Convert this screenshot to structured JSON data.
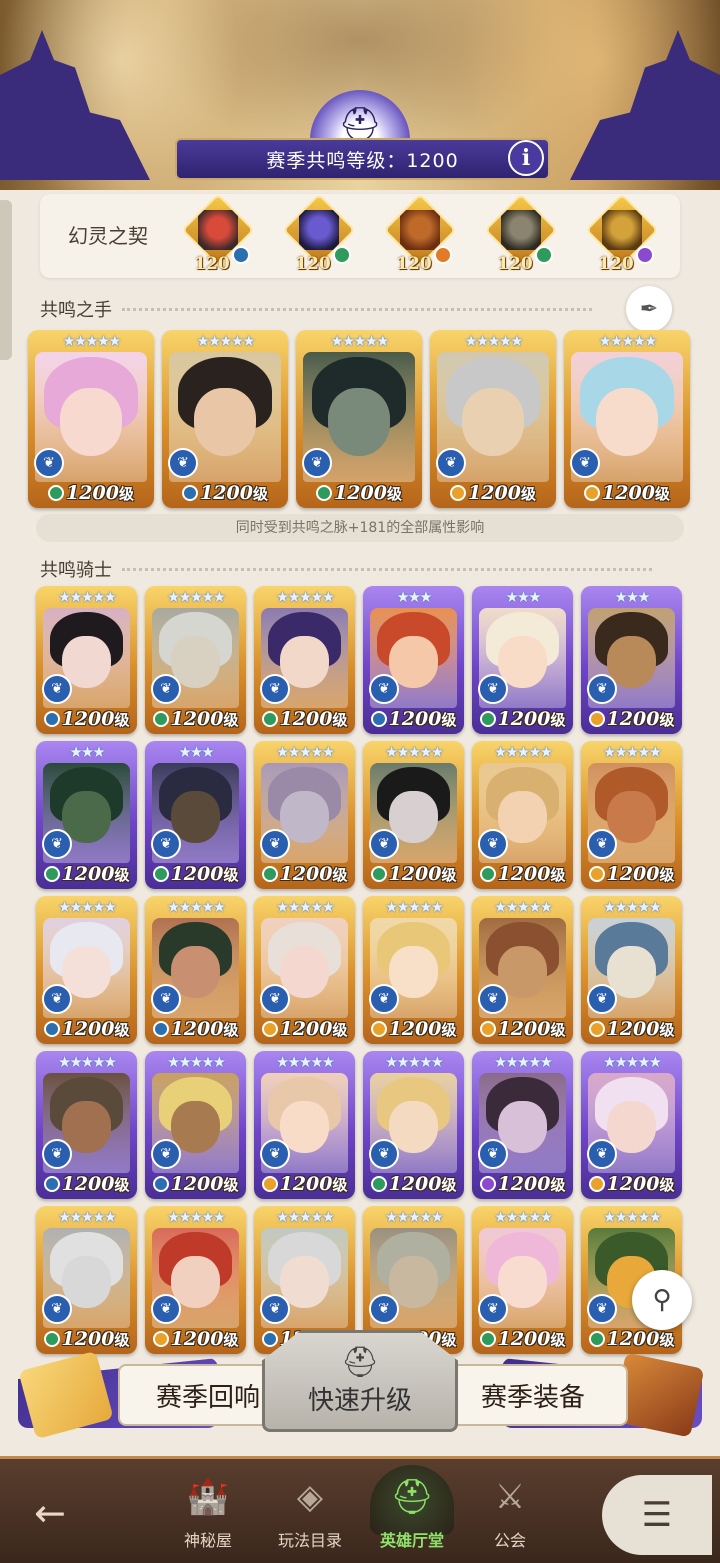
{
  "header": {
    "season_level_label": "赛季共鸣等级：1200",
    "info_label": "i"
  },
  "contract": {
    "title": "幻灵之契",
    "items": [
      {
        "level": "120",
        "colors": [
          "#d84a3a",
          "#3a2a2a"
        ],
        "elem_color": "#2c6fb0"
      },
      {
        "level": "120",
        "colors": [
          "#6a5ad0",
          "#1d1a40"
        ],
        "elem_color": "#2e9a5e"
      },
      {
        "level": "120",
        "colors": [
          "#c06a2a",
          "#6b2e10"
        ],
        "elem_color": "#e27a2a"
      },
      {
        "level": "120",
        "colors": [
          "#8a8470",
          "#2e2a20"
        ],
        "elem_color": "#2e9a5e"
      },
      {
        "level": "120",
        "colors": [
          "#d4a23a",
          "#5a3a10"
        ],
        "elem_color": "#8a4ad0"
      }
    ]
  },
  "hand": {
    "label": "共鸣之手",
    "note": "同时受到共鸣之脉+181的全部属性影响",
    "cards": [
      {
        "level": "1200",
        "suffix": "级",
        "stars": "★★★★★",
        "frame": "gold",
        "hair": "#e7a9d8",
        "face": "#f7d9d0",
        "bg": "#f3d3ea",
        "elem": "#2e9a5e"
      },
      {
        "level": "1200",
        "suffix": "级",
        "stars": "★★★★★",
        "frame": "gold",
        "hair": "#2a221e",
        "face": "#e9c7a6",
        "bg": "#d8c6a0",
        "elem": "#2c6fb0"
      },
      {
        "level": "1200",
        "suffix": "级",
        "stars": "★★★★★",
        "frame": "gold",
        "hair": "#1f2a2a",
        "face": "#7a8a7a",
        "bg": "#4a5a4a",
        "elem": "#2e9a5e"
      },
      {
        "level": "1200",
        "suffix": "级",
        "stars": "★★★★★",
        "frame": "gold",
        "hair": "#c8c8c8",
        "face": "#e8d0b0",
        "bg": "#d0c8b0",
        "elem": "#e8a22a"
      },
      {
        "level": "1200",
        "suffix": "级",
        "stars": "★★★★★",
        "frame": "gold",
        "hair": "#a8d8e8",
        "face": "#f7dccc",
        "bg": "#f2d0d8",
        "elem": "#e8a22a"
      }
    ]
  },
  "knights": {
    "label": "共鸣骑士",
    "cards": [
      {
        "level": "1200",
        "suffix": "级",
        "stars": "★★★★★",
        "frame": "gold",
        "hair": "#1e1a1e",
        "face": "#f1d8d0",
        "bg": "#d6b0c0",
        "elem": "#2c6fb0"
      },
      {
        "level": "1200",
        "suffix": "级",
        "stars": "★★★★★",
        "frame": "gold",
        "hair": "#d6d6d0",
        "face": "#d8d0c0",
        "bg": "#a8a8a0",
        "elem": "#2e9a5e"
      },
      {
        "level": "1200",
        "suffix": "级",
        "stars": "★★★★★",
        "frame": "gold",
        "hair": "#3a2a6a",
        "face": "#f2d8c8",
        "bg": "#8a7ab0",
        "elem": "#2e9a5e"
      },
      {
        "level": "1200",
        "suffix": "级",
        "stars": "★★★",
        "frame": "purple",
        "hair": "#c84a2a",
        "face": "#f4c8a8",
        "bg": "#e89050",
        "elem": "#2c6fb0"
      },
      {
        "level": "1200",
        "suffix": "级",
        "stars": "★★★",
        "frame": "purple",
        "hair": "#f4ead8",
        "face": "#f8dcc8",
        "bg": "#f0dcc8",
        "elem": "#2e9a5e"
      },
      {
        "level": "1200",
        "suffix": "级",
        "stars": "★★★",
        "frame": "purple",
        "hair": "#3a2a1e",
        "face": "#b88a5a",
        "bg": "#c0a070",
        "elem": "#e8a22a"
      },
      {
        "level": "1200",
        "suffix": "级",
        "stars": "★★★",
        "frame": "purple",
        "hair": "#1e3a2a",
        "face": "#4a6a4a",
        "bg": "#2a4a3a",
        "elem": "#2e9a5e"
      },
      {
        "level": "1200",
        "suffix": "级",
        "stars": "★★★",
        "frame": "purple",
        "hair": "#2a2a40",
        "face": "#5a4a3a",
        "bg": "#3a3a5a",
        "elem": "#2e9a5e"
      },
      {
        "level": "1200",
        "suffix": "级",
        "stars": "★★★★★",
        "frame": "gold",
        "hair": "#9a8aa8",
        "face": "#c0b8c8",
        "bg": "#a898b8",
        "elem": "#2e9a5e"
      },
      {
        "level": "1200",
        "suffix": "级",
        "stars": "★★★★★",
        "frame": "gold",
        "hair": "#1a1a1a",
        "face": "#d8d0d0",
        "bg": "#6a7a6a",
        "elem": "#2e9a5e"
      },
      {
        "level": "1200",
        "suffix": "级",
        "stars": "★★★★★",
        "frame": "gold",
        "hair": "#d8b070",
        "face": "#f2d2b0",
        "bg": "#e8c890",
        "elem": "#2e9a5e"
      },
      {
        "level": "1200",
        "suffix": "级",
        "stars": "★★★★★",
        "frame": "gold",
        "hair": "#b05a2a",
        "face": "#c87a4a",
        "bg": "#d09060",
        "elem": "#e8a22a"
      },
      {
        "level": "1200",
        "suffix": "级",
        "stars": "★★★★★",
        "frame": "gold",
        "hair": "#e8e8f0",
        "face": "#f4e0d8",
        "bg": "#e0d0e0",
        "elem": "#2c6fb0"
      },
      {
        "level": "1200",
        "suffix": "级",
        "stars": "★★★★★",
        "frame": "gold",
        "hair": "#2a3a2a",
        "face": "#c89070",
        "bg": "#b07050",
        "elem": "#2c6fb0"
      },
      {
        "level": "1200",
        "suffix": "级",
        "stars": "★★★★★",
        "frame": "gold",
        "hair": "#e8e0d8",
        "face": "#f4d8d0",
        "bg": "#f0d0c0",
        "elem": "#e8a22a"
      },
      {
        "level": "1200",
        "suffix": "级",
        "stars": "★★★★★",
        "frame": "gold",
        "hair": "#e8c878",
        "face": "#f8e0c8",
        "bg": "#f0d8a8",
        "elem": "#e8a22a"
      },
      {
        "level": "1200",
        "suffix": "级",
        "stars": "★★★★★",
        "frame": "gold",
        "hair": "#8a5030",
        "face": "#c89868",
        "bg": "#a06a40",
        "elem": "#e8a22a"
      },
      {
        "level": "1200",
        "suffix": "级",
        "stars": "★★★★★",
        "frame": "gold",
        "hair": "#5a7a9a",
        "face": "#e8e0d0",
        "bg": "#c8d0d8",
        "elem": "#e8a22a"
      },
      {
        "level": "1200",
        "suffix": "级",
        "stars": "★★★★★",
        "frame": "purple",
        "hair": "#5a4a3a",
        "face": "#a07050",
        "bg": "#6a5040",
        "elem": "#2c6fb0"
      },
      {
        "level": "1200",
        "suffix": "级",
        "stars": "★★★★★",
        "frame": "purple",
        "hair": "#e8d078",
        "face": "#a87a50",
        "bg": "#c8a060",
        "elem": "#2c6fb0"
      },
      {
        "level": "1200",
        "suffix": "级",
        "stars": "★★★★★",
        "frame": "purple",
        "hair": "#e8c8a8",
        "face": "#f8dcc8",
        "bg": "#f0d0b8",
        "elem": "#e8a22a"
      },
      {
        "level": "1200",
        "suffix": "级",
        "stars": "★★★★★",
        "frame": "purple",
        "hair": "#e8c880",
        "face": "#f4dac0",
        "bg": "#e8d0a0",
        "elem": "#2e9a5e"
      },
      {
        "level": "1200",
        "suffix": "级",
        "stars": "★★★★★",
        "frame": "purple",
        "hair": "#3a2a3a",
        "face": "#d8c0d8",
        "bg": "#8a6a8a",
        "elem": "#8a4ad0"
      },
      {
        "level": "1200",
        "suffix": "级",
        "stars": "★★★★★",
        "frame": "purple",
        "hair": "#f0e0f0",
        "face": "#f4d8d0",
        "bg": "#d8a8c8",
        "elem": "#e8a22a"
      },
      {
        "level": "1200",
        "suffix": "级",
        "stars": "★★★★★",
        "frame": "gold",
        "hair": "#e0e0e0",
        "face": "#d8d8d8",
        "bg": "#b0b0b0",
        "elem": "#2e9a5e"
      },
      {
        "level": "1200",
        "suffix": "级",
        "stars": "★★★★★",
        "frame": "gold",
        "hair": "#c03a2a",
        "face": "#f2d0c0",
        "bg": "#d86a5a",
        "elem": "#e8a22a"
      },
      {
        "level": "1200",
        "suffix": "级",
        "stars": "★★★★★",
        "frame": "gold",
        "hair": "#d8d8d8",
        "face": "#f0dcd0",
        "bg": "#c0c8c0",
        "elem": "#2c6fb0"
      },
      {
        "level": "1200",
        "suffix": "级",
        "stars": "★★★★★",
        "frame": "gold",
        "hair": "#b0b0a0",
        "face": "#c8b8a0",
        "bg": "#9a9080",
        "elem": "#2e9a5e"
      },
      {
        "level": "1200",
        "suffix": "级",
        "stars": "★★★★★",
        "frame": "gold",
        "hair": "#f0b8d8",
        "face": "#f8dcd0",
        "bg": "#f0c8d8",
        "elem": "#2e9a5e"
      },
      {
        "level": "1200",
        "suffix": "级",
        "stars": "★★★★★",
        "frame": "gold",
        "hair": "#3a5a2a",
        "face": "#e8a83a",
        "bg": "#5a7a3a",
        "elem": "#2e9a5e"
      }
    ]
  },
  "actions": {
    "left_label": "赛季回响",
    "center_label": "快速升级",
    "right_label": "赛季装备"
  },
  "nav": {
    "items": [
      {
        "label": "神秘屋",
        "icon": "mystery-house-icon",
        "glyph": "🏰"
      },
      {
        "label": "玩法目录",
        "icon": "catalog-icon",
        "glyph": "◈"
      },
      {
        "label": "英雄厅堂",
        "icon": "hero-hall-icon",
        "glyph": "⛑"
      },
      {
        "label": "公会",
        "icon": "guild-icon",
        "glyph": "⚔"
      }
    ]
  },
  "colors": {
    "accent_purple": "#4b3a9a",
    "gold": "#d9902b",
    "active_green": "#8ce36a"
  }
}
